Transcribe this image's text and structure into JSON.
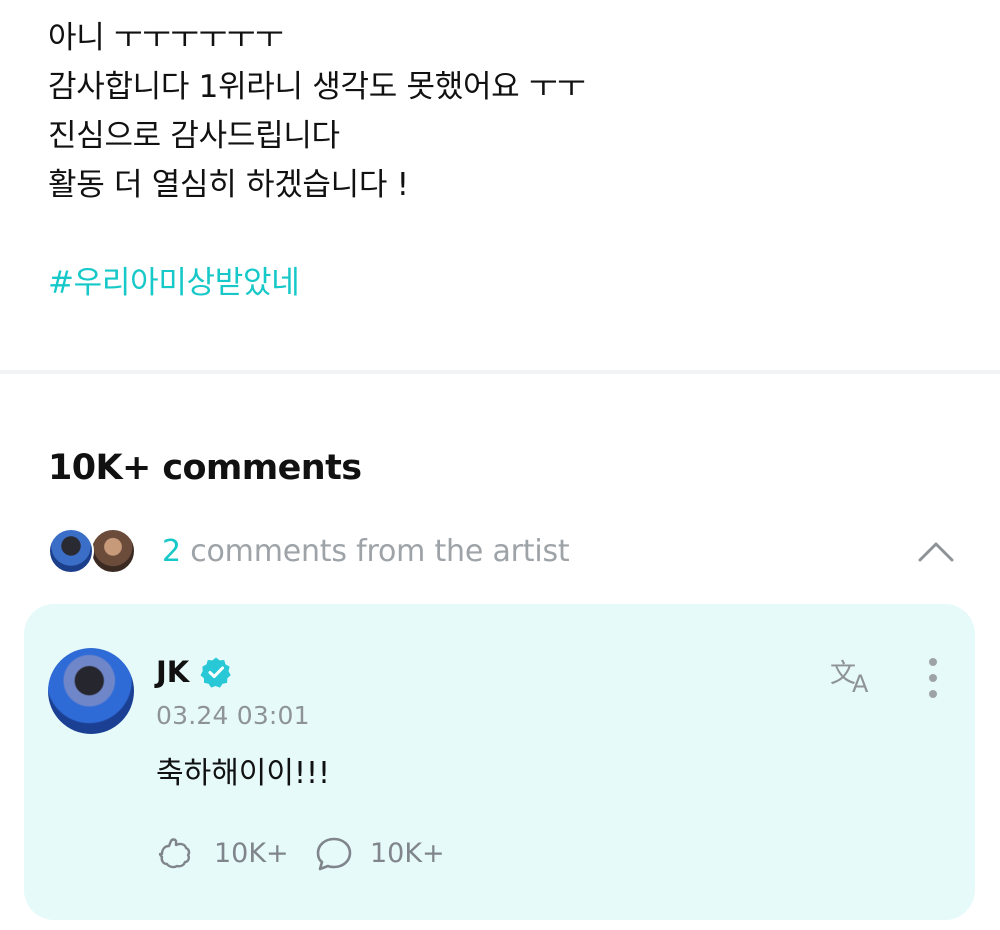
{
  "post": {
    "lines": [
      "아니 ㅜㅜㅜㅜㅜㅜ",
      "감사합니다 1위라니 생각도 못했어요 ㅜㅜ",
      "진심으로 감사드립니다",
      "활동 더 열심히 하겠습니다 !"
    ],
    "hashtag": "#우리아미상받았네"
  },
  "comments": {
    "count_label": "10K+ comments",
    "artist_count": "2",
    "artist_label": "comments from the artist"
  },
  "comment": {
    "author": "JK",
    "timestamp": "03.24 03:01",
    "text": "축하해이이!!!",
    "likes": "10K+",
    "replies": "10K+"
  },
  "colors": {
    "accent": "#16c8c8",
    "card_bg": "#e6fafa",
    "muted": "#9ea3a8"
  },
  "icons": {
    "chevron": "chevron-up-icon",
    "verified": "verified-badge-icon",
    "translate": "translate-icon",
    "more": "more-vertical-icon",
    "like": "like-icon",
    "reply": "comment-icon"
  }
}
